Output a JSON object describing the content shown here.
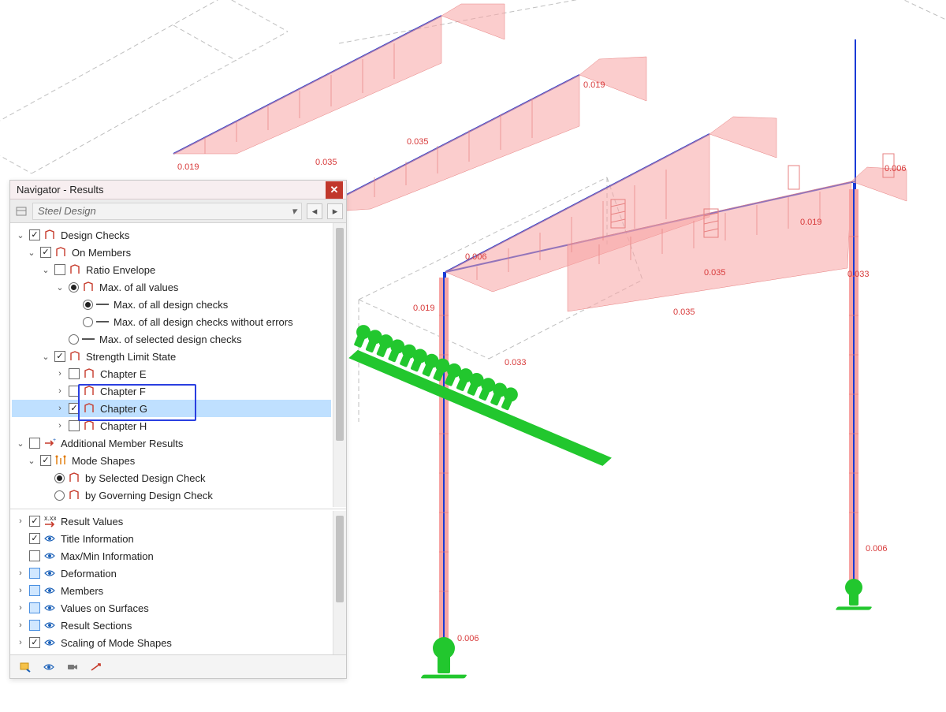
{
  "panel": {
    "title": "Navigator - Results",
    "dropdown_label": "Steel Design",
    "close_tip": "Close"
  },
  "tree": {
    "design_checks": "Design Checks",
    "on_members": "On Members",
    "ratio_envelope": "Ratio Envelope",
    "max_all_values": "Max. of all values",
    "max_all_checks": "Max. of all design checks",
    "max_all_checks_noerr": "Max. of all design checks without errors",
    "max_selected_checks": "Max. of selected design checks",
    "strength_limit": "Strength Limit State",
    "chapter_e": "Chapter E",
    "chapter_f": "Chapter F",
    "chapter_g": "Chapter G",
    "chapter_h": "Chapter H",
    "addl_results": "Additional Member Results",
    "mode_shapes": "Mode Shapes",
    "by_selected": "by Selected Design Check",
    "by_governing": "by Governing Design Check",
    "result_values": "Result Values",
    "title_info": "Title Information",
    "maxmin_info": "Max/Min Information",
    "deformation": "Deformation",
    "members": "Members",
    "vals_surfaces": "Values on Surfaces",
    "result_sections": "Result Sections",
    "scaling_mode": "Scaling of Mode Shapes"
  },
  "values": {
    "v006": "0.006",
    "v019": "0.019",
    "v033": "0.033",
    "v035": "0.035"
  },
  "colors": {
    "accent_blue": "#2a3fe0",
    "accent_red": "#c63a2b",
    "select_bg": "#bfe0ff",
    "support_green": "#22c72e"
  }
}
